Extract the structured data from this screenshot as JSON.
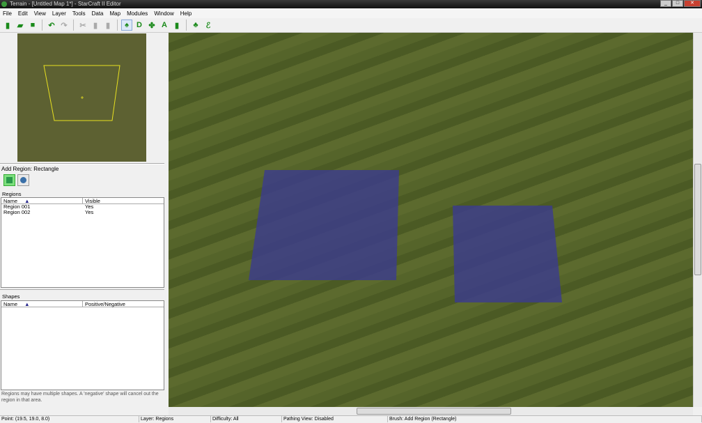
{
  "window": {
    "title": "Terrain - [Untitled Map 1*] - StarCraft II Editor",
    "minimize": "_",
    "maximize": "□",
    "close": "✕"
  },
  "menu": [
    "File",
    "Edit",
    "View",
    "Layer",
    "Tools",
    "Data",
    "Map",
    "Modules",
    "Window",
    "Help"
  ],
  "toolbar": [
    {
      "name": "new-icon",
      "glyph": "▮"
    },
    {
      "name": "open-icon",
      "glyph": "▰"
    },
    {
      "name": "save-icon",
      "glyph": "■"
    },
    {
      "name": "undo-icon",
      "glyph": "↶"
    },
    {
      "name": "redo-icon",
      "glyph": "↷",
      "disabled": true
    },
    {
      "name": "cut-icon",
      "glyph": "✂",
      "disabled": true
    },
    {
      "name": "copy-icon",
      "glyph": "▮",
      "disabled": true
    },
    {
      "name": "paste-icon",
      "glyph": "▮",
      "disabled": true
    },
    {
      "name": "terrain-icon",
      "glyph": "♠",
      "active": true
    },
    {
      "name": "doodads-icon",
      "glyph": "D"
    },
    {
      "name": "units-icon",
      "glyph": "✤"
    },
    {
      "name": "text-icon",
      "glyph": "A"
    },
    {
      "name": "points-icon",
      "glyph": "▮"
    },
    {
      "name": "triggers-icon",
      "glyph": "♣"
    },
    {
      "name": "data-icon",
      "glyph": "ℰ"
    }
  ],
  "add_region": {
    "label": "Add Region:",
    "value": "Rectangle"
  },
  "regions": {
    "title": "Regions",
    "columns": [
      "Name",
      "Visible"
    ],
    "rows": [
      [
        "Region 001",
        "Yes"
      ],
      [
        "Region 002",
        "Yes"
      ]
    ]
  },
  "shapes": {
    "title": "Shapes",
    "columns": [
      "Name",
      "Positive/Negative"
    ],
    "rows": []
  },
  "hint": "Regions may have multiple shapes. A 'negative' shape will cancel out the region in that area.",
  "status": {
    "point": "Point: (19.5, 19.0, 8.0)",
    "layer": "Layer: Regions",
    "difficulty": "Difficulty: All",
    "pathing": "Pathing View: Disabled",
    "brush": "Brush: Add Region (Rectangle)"
  },
  "colors": {
    "region_fill": "#3c3c8c",
    "grass": "#55642a",
    "minimap_frame": "#e8e020"
  }
}
